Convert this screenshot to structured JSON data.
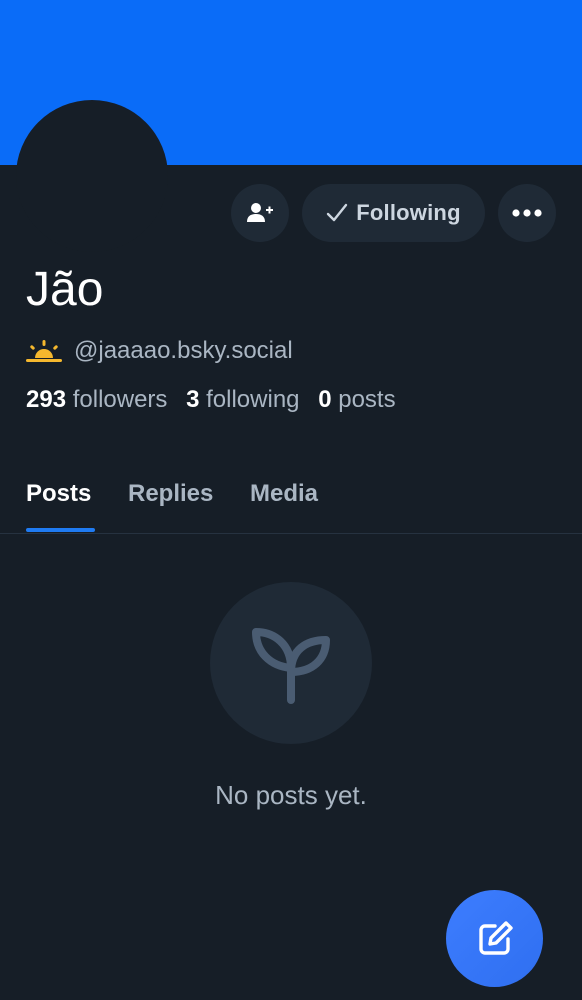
{
  "profile": {
    "display_name": "Jão",
    "handle": "@jaaaao.bsky.social",
    "handle_emoji": "🌅",
    "stats": {
      "followers_count": "293",
      "followers_label": "followers",
      "following_count": "3",
      "following_label": "following",
      "posts_count": "0",
      "posts_label": "posts"
    }
  },
  "actions": {
    "follow_label": "Following",
    "add_user_icon": "person-plus-icon",
    "more_icon": "ellipsis-icon"
  },
  "tabs": [
    {
      "label": "Posts",
      "active": true
    },
    {
      "label": "Replies",
      "active": false
    },
    {
      "label": "Media",
      "active": false
    }
  ],
  "empty_state": {
    "icon": "sprout-icon",
    "message": "No posts yet."
  },
  "fab": {
    "icon": "compose-icon"
  },
  "colors": {
    "banner": "#0a6cf8",
    "background": "#161e27",
    "button_bg": "#1f2a36",
    "accent": "#1f7bf2"
  }
}
